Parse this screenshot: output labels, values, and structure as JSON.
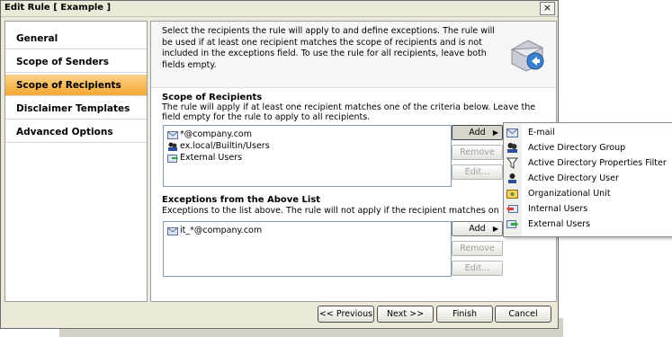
{
  "window": {
    "title": "Edit Rule [ Example ]",
    "close_symbol": "×"
  },
  "sidebar": {
    "items": [
      {
        "label": "General",
        "selected": false
      },
      {
        "label": "Scope of Senders",
        "selected": false
      },
      {
        "label": "Scope of Recipients",
        "selected": true
      },
      {
        "label": "Disclaimer Templates",
        "selected": false
      },
      {
        "label": "Advanced Options",
        "selected": false
      }
    ]
  },
  "header": {
    "text": "Select the recipients the rule will apply to and define exceptions. The rule will be used if at least one recipient matches the scope of recipients and is not included in the exceptions field. To use the rule for all recipients, leave both fields empty.",
    "icon": "user-mail-icon"
  },
  "scope": {
    "title": "Scope of Recipients",
    "description": "The rule will apply if at least one recipient matches one of the criteria below. Leave the field empty for the rule to apply to all recipients.",
    "entries": [
      {
        "text": "*@company.com",
        "icon": "email-icon"
      },
      {
        "text": "ex.local/Builtin/Users",
        "icon": "ad-group-icon"
      },
      {
        "text": "External Users",
        "icon": "external-users-icon"
      }
    ],
    "add_label": "Add",
    "remove_label": "Remove",
    "edit_label": "Edit..."
  },
  "exceptions": {
    "title": "Exceptions from the Above List",
    "description": "Exceptions to the list above. The rule will not apply if the recipient matches one of the following criter",
    "entries": [
      {
        "text": "it_*@company.com",
        "icon": "email-icon"
      }
    ],
    "add_label": "Add",
    "remove_label": "Remove",
    "edit_label": "Edit..."
  },
  "footer": {
    "previous_label": "<< Previous",
    "next_label": "Next >>",
    "finish_label": "Finish",
    "cancel_label": "Cancel"
  },
  "add_menu": {
    "items": [
      {
        "label": "E-mail",
        "icon": "email-icon"
      },
      {
        "label": "Active Directory Group",
        "icon": "ad-group-icon"
      },
      {
        "label": "Active Directory Properties Filter",
        "icon": "filter-icon"
      },
      {
        "label": "Active Directory User",
        "icon": "ad-user-icon"
      },
      {
        "label": "Organizational Unit",
        "icon": "org-unit-icon"
      },
      {
        "label": "Internal Users",
        "icon": "internal-users-icon"
      },
      {
        "label": "External Users",
        "icon": "external-users-icon"
      }
    ]
  },
  "background_window": {
    "text": "…"
  },
  "colors": {
    "selected_item": "#f5a732",
    "listbox_border": "#7f9db9",
    "dialog_bg": "#ece9d8"
  }
}
